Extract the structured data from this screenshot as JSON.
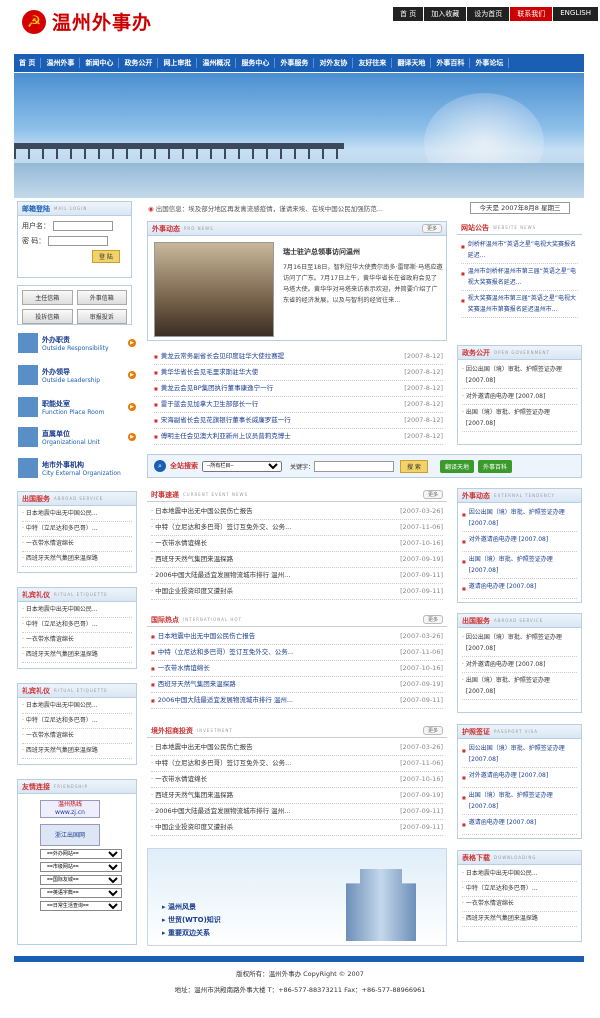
{
  "site": {
    "title": "温州外事办",
    "emblem": "☭"
  },
  "topbar": [
    "首 页",
    "加入收藏",
    "设为首页",
    "联系我们",
    "ENGLISH"
  ],
  "nav": [
    "首 页",
    "温州外事",
    "新闻中心",
    "政务公开",
    "网上审批",
    "温州概况",
    "服务中心",
    "外事服务",
    "对外友协",
    "友好往来",
    "翻译天地",
    "外事百科",
    "外事论坛"
  ],
  "login": {
    "title": "邮箱登陆",
    "en": "MAIL LOGIN",
    "user": "用户名：",
    "pwd": "密 码：",
    "btn": "登 陆"
  },
  "buttons": [
    "主任信箱",
    "外事信箱",
    "投拆信箱",
    "审报投诉"
  ],
  "sidenav": [
    {
      "cn": "外办职责",
      "en": "Outside Responsibility"
    },
    {
      "cn": "外办领导",
      "en": "Outside Leadership"
    },
    {
      "cn": "职能处室",
      "en": "Function Place Room"
    },
    {
      "cn": "直属单位",
      "en": "Organizational Unit"
    },
    {
      "cn": "地市外事机构",
      "en": "City External Organization"
    }
  ],
  "ticker": "出国信息：埃及部分地区再发禽流感疫情，谨请来埃、在埃中国公民加强防范...",
  "date": "今天是 2007年8月8 星期三",
  "news": {
    "title": "外事动态",
    "en": "PRO NEWS",
    "more": "更多",
    "headline": "瑞士驻沪总领事访问温州",
    "body": "7月16日至18日，智利驻华大使费尔南多·雷耶斯·马塔应邀访问了广东。7月17日上午，黄华华省长在省政府会见了马塔大使。黄华华对马塔来访表示欢迎，并简要介绍了广东省的经济发展，以及与智利的经贸往来...",
    "items": [
      {
        "t": "黄龙云常务副省长会见印度驻华大使拉赛提",
        "d": "[2007-8-12]"
      },
      {
        "t": "黄华华省长会见毛里求斯驻华大使",
        "d": "[2007-8-12]"
      },
      {
        "t": "黄龙云会见BP集团执行董事康逸宁一行",
        "d": "[2007-8-12]"
      },
      {
        "t": "雷于蓝会见加拿大卫生部部长一行",
        "d": "[2007-8-12]"
      },
      {
        "t": "宋海副省长会见花旗银行董事长威廉罗兹一行",
        "d": "[2007-8-12]"
      },
      {
        "t": "傅明主任会见澳大利亚新州上议员普莉克博士",
        "d": "[2007-8-12]"
      }
    ]
  },
  "notice": {
    "title": "网站公告",
    "en": "WEBSITE NEWS",
    "items": [
      "剑桥杯温州市“英语之星”电视大奖赛报名延迟...",
      "温州市剑桥杯温州市第三届“英语之星”电视大奖赛报名延迟...",
      "视大奖赛温州市第三届“英语之星”电视大奖赛温州市第赛报名延迟温州市..."
    ]
  },
  "gov": {
    "title": "政务公开",
    "en": "OPEN GOVERNMENT",
    "items": [
      "因公出国（境）审批、护照签证办理 [2007.08]",
      "对外邀请函电办理 [2007.08]",
      "出国（境）审批、护照签证办理 [2007.08]"
    ]
  },
  "search": {
    "label": "全站搜索",
    "sel": "--所有栏目--",
    "kw": "关键字：",
    "btn": "搜 索",
    "b1": "翻译天地",
    "b2": "外事百科"
  },
  "service1": {
    "title": "出国服务",
    "en": "ABROAD SERVICE",
    "items": [
      "日本地震中出无中国公民...",
      "中特（立尼达和多巴哥）...",
      "一衣带水情谊绵长",
      "西班牙天然气集团来温探路"
    ]
  },
  "etiq1": {
    "title": "礼宾礼仪",
    "en": "RITUAL ETIQUETTE",
    "items": [
      "日本地震中出无中国公民...",
      "中特（立尼达和多巴哥）...",
      "一衣带水情谊绵长",
      "西班牙天然气集团来温探路"
    ]
  },
  "etiq2": {
    "title": "礼宾礼仪",
    "en": "RITUAL ETIQUETTE",
    "items": [
      "日本地震中出无中国公民...",
      "中特（立尼达和多巴哥）...",
      "一衣带水情谊绵长",
      "西班牙天然气集团来温探路"
    ]
  },
  "friend": {
    "title": "友情连接",
    "en": "FRIENDSHIP",
    "l1": "温州热线",
    "l1u": "www.zj.cn",
    "l2": "浙江出国网",
    "sels": [
      "==外办网站==",
      "==市级网站==",
      "==国际友城==",
      "==英语字典==",
      "==日常生活查询=="
    ]
  },
  "current": {
    "title": "时事速递",
    "en": "CURRENT EVENT NEWS",
    "more": "更多",
    "items": [
      {
        "t": "日本地震中出无中国公民伤亡报告",
        "d": "[2007-03-26]"
      },
      {
        "t": "中特（立尼达和多巴哥）签订互免外交、公务...",
        "d": "[2007-11-06]"
      },
      {
        "t": "一衣带水情谊绵长",
        "d": "[2007-10-16]"
      },
      {
        "t": "西班牙天然气集团来温探路",
        "d": "[2007-09-19]"
      },
      {
        "t": "2006中国大陆最适宜发展物流城市排行 温州...",
        "d": "[2007-09-11]"
      },
      {
        "t": "中国企业投资印度又遭封杀",
        "d": "[2007-09-11]"
      }
    ]
  },
  "hot": {
    "title": "国际热点",
    "en": "INTERNATIONAL HOT",
    "more": "更多",
    "items": [
      {
        "t": "日本地震中出无中国公民伤亡报告",
        "d": "[2007-03-26]"
      },
      {
        "t": "中特（立尼达和多巴哥）签订互免外交、公务...",
        "d": "[2007-11-06]"
      },
      {
        "t": "一衣带水情谊绵长",
        "d": "[2007-10-16]"
      },
      {
        "t": "西班牙天然气集团来温探路",
        "d": "[2007-09-19]"
      },
      {
        "t": "2006中国大陆最适宜发展物流城市排行 温州...",
        "d": "[2007-09-11]"
      }
    ]
  },
  "invest": {
    "title": "境外招商投资",
    "en": "INVESTMENT",
    "more": "更多",
    "items": [
      {
        "t": "日本地震中出无中国公民伤亡报告",
        "d": "[2007-03-26]"
      },
      {
        "t": "中特（立尼达和多巴哥）签订互免外交、公务...",
        "d": "[2007-11-06]"
      },
      {
        "t": "一衣带水情谊绵长",
        "d": "[2007-10-16]"
      },
      {
        "t": "西班牙天然气集团来温探路",
        "d": "[2007-09-19]"
      },
      {
        "t": "2006中国大陆最适宜发展物流城市排行 温州...",
        "d": "[2007-09-11]"
      },
      {
        "t": "中国企业投资印度又遭封杀",
        "d": "[2007-09-11]"
      }
    ]
  },
  "links": [
    "温州风景",
    "世贸(WTO)知识",
    "重要双边关系"
  ],
  "ext": {
    "title": "外事动态",
    "en": "EXTERNAL TENDENCY",
    "items": [
      "因公出国（境）审批、护照签证办理 [2007.08]",
      "对外邀请函电办理 [2007.08]",
      "出国（境）审批、护照签证办理 [2007.08]",
      "邀请函电办理 [2007.08]"
    ]
  },
  "abroad": {
    "title": "出国服务",
    "en": "ABROAD SERVICE",
    "items": [
      "因公出国（境）审批、护照签证办理 [2007.08]",
      "对外邀请函电办理 [2007.08]",
      "出国（境）审批、护照签证办理 [2007.08]"
    ]
  },
  "passport": {
    "title": "护照签证",
    "en": "PASSPORT VISA",
    "items": [
      "因公出国（境）审批、护照签证办理 [2007.08]",
      "对外邀请函电办理 [2007.08]",
      "出国（境）审批、护照签证办理 [2007.08]",
      "邀请函电办理 [2007.08]"
    ]
  },
  "download": {
    "title": "表格下载",
    "en": "DOWNLOADING",
    "items": [
      "日本地震中出无中国公民...",
      "中特（立尼达和多巴哥）...",
      "一衣带水情谊绵长",
      "西班牙天然气集团来温探路"
    ]
  },
  "footer": {
    "l1": "版权所有：温州外事办 CopyRight © 2007",
    "l2": "地址：温州市洪殿南路外事大楼 T：+86-577-88373211 Fax：+86-577-88966961"
  }
}
